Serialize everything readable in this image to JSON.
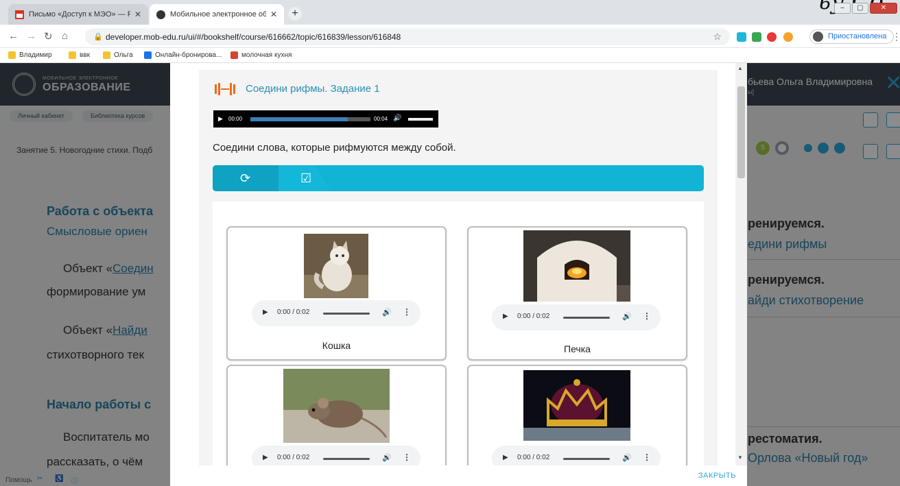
{
  "browser": {
    "tabs": [
      {
        "title": "Письмо «Доступ к МЭО» — Род",
        "active": false
      },
      {
        "title": "Мобильное электронное обра",
        "active": true
      }
    ],
    "url": "developer.mob-edu.ru/ui/#/bookshelf/course/616662/topic/616839/lesson/616848",
    "profile_status": "Приостановлена",
    "bookmarks": [
      "Владимир",
      "ввк",
      "Ольга",
      "Онлайн-бронирова...",
      "молочная кухня"
    ],
    "handwriting": "ьу Со"
  },
  "site": {
    "logo_small": "МОБИЛЬНОЕ ЭЛЕКТРОННОЕ",
    "logo_big": "ОБРАЗОВАНИЕ",
    "user_name": "бьева Ольга Владимировна",
    "user_sub": "ы]",
    "breadcrumbs": [
      "Личный кабинет",
      "Библиотека курсов"
    ],
    "lesson_title": "Занятие 5. Новогодние стихи. Подб",
    "progress_number": "5",
    "left_texts": {
      "h1": "Работа с объекта",
      "h1_sub": "Смысловые ориен",
      "p1_start": "Объект «",
      "p1_link": "Соедин",
      "p1_line2": "формирование ум",
      "p2_start": "Объект «",
      "p2_link": "Найди",
      "p2_line2": "стихотворного тек",
      "h2": "Начало работы с",
      "p3": "Воспитатель мо",
      "p3_line2": "рассказать, о чём"
    },
    "right_texts": {
      "r1_title": "ренируемся.",
      "r1_sub": "едини рифмы",
      "r2_title": "ренируемся.",
      "r2_sub": "айди стихотворение",
      "r3_title": "рестоматия.",
      "r3_sub": "Орлова «Новый год»"
    },
    "footer": "Помощь"
  },
  "modal": {
    "task_title": "Соедини рифмы. Задание 1",
    "audio": {
      "current": "00:00",
      "duration": "00:04",
      "progress": 0.81
    },
    "instruction": "Соедини слова, которые рифмуются между собой.",
    "close_label": "ЗАКРЫТЬ",
    "cards": [
      {
        "word": "Кошка",
        "time": "0:00 / 0:02",
        "image": "cat"
      },
      {
        "word": "Печка",
        "time": "0:00 / 0:02",
        "image": "stove"
      },
      {
        "word": "",
        "time": "0:00 / 0:02",
        "image": "mouse"
      },
      {
        "word": "",
        "time": "0:00 / 0:02",
        "image": "crown"
      }
    ]
  },
  "colors": {
    "accent": "#11b4d4",
    "header": "#3c4650",
    "title": "#2a8fb5",
    "task_icon": "#f06a1a"
  }
}
